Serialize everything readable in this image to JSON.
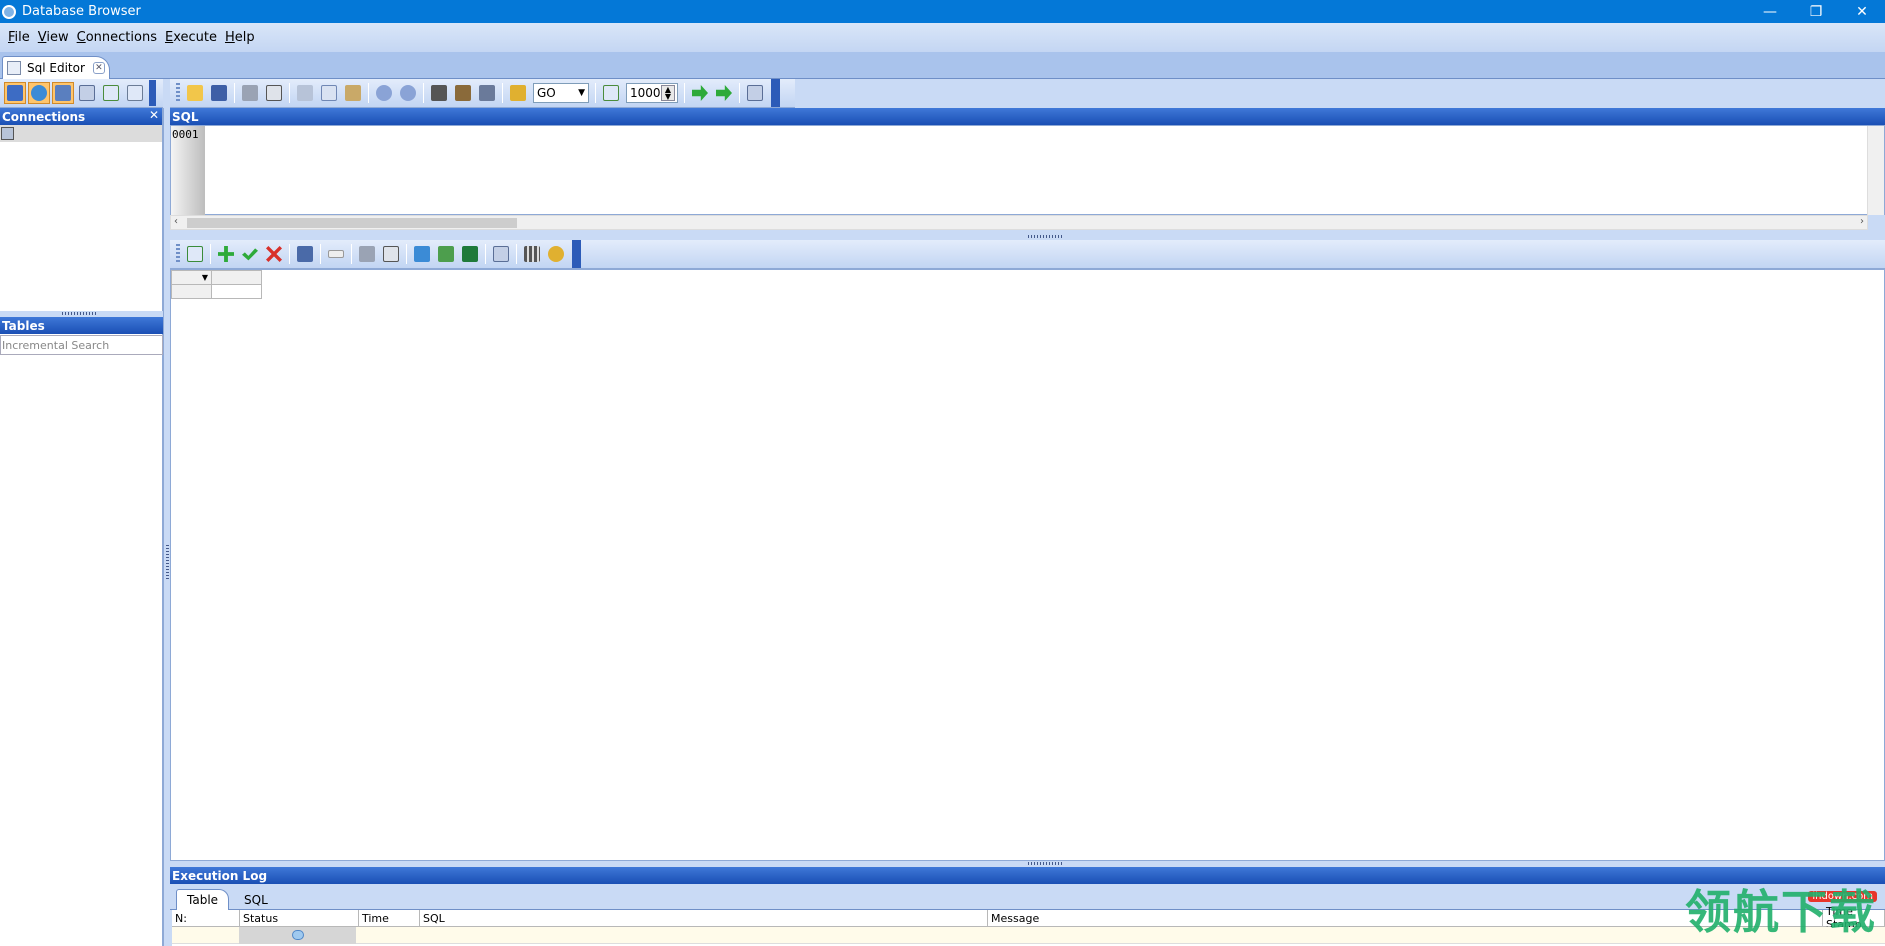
{
  "window": {
    "title": "Database Browser",
    "minimize_glyph": "—",
    "restore_glyph": "❐",
    "close_glyph": "✕"
  },
  "menu": [
    {
      "label": "File",
      "mnemonic": "F",
      "rest": "ile"
    },
    {
      "label": "View",
      "mnemonic": "V",
      "rest": "iew"
    },
    {
      "label": "Connections",
      "mnemonic": "C",
      "rest": "onnections"
    },
    {
      "label": "Execute",
      "mnemonic": "E",
      "rest": "xecute"
    },
    {
      "label": "Help",
      "mnemonic": "H",
      "rest": "elp"
    }
  ],
  "doc_tab": {
    "label": "Sql Editor",
    "close_glyph": "✕"
  },
  "toolbar": {
    "go_value": "GO",
    "max_rows_value": "1000"
  },
  "connections_panel": {
    "title": "Connections",
    "close_glyph": "✕"
  },
  "tables_panel": {
    "title": "Tables",
    "search_placeholder": "Incremental Search"
  },
  "sql_panel": {
    "title": "SQL",
    "line_number": "0001"
  },
  "execution_log": {
    "title": "Execution Log",
    "tabs": [
      "Table",
      "SQL"
    ],
    "columns": [
      "N:",
      "Status",
      "Time",
      "SQL",
      "Message",
      "Time Stamp"
    ]
  },
  "watermark": {
    "text": "领航下载",
    "tag": "lhdown.com"
  },
  "colors": {
    "titlebar": "#0478d7",
    "panel_header": "#1a4fb4",
    "toolbar": "#c2d5f3",
    "checked_button": "#ffc56b"
  }
}
